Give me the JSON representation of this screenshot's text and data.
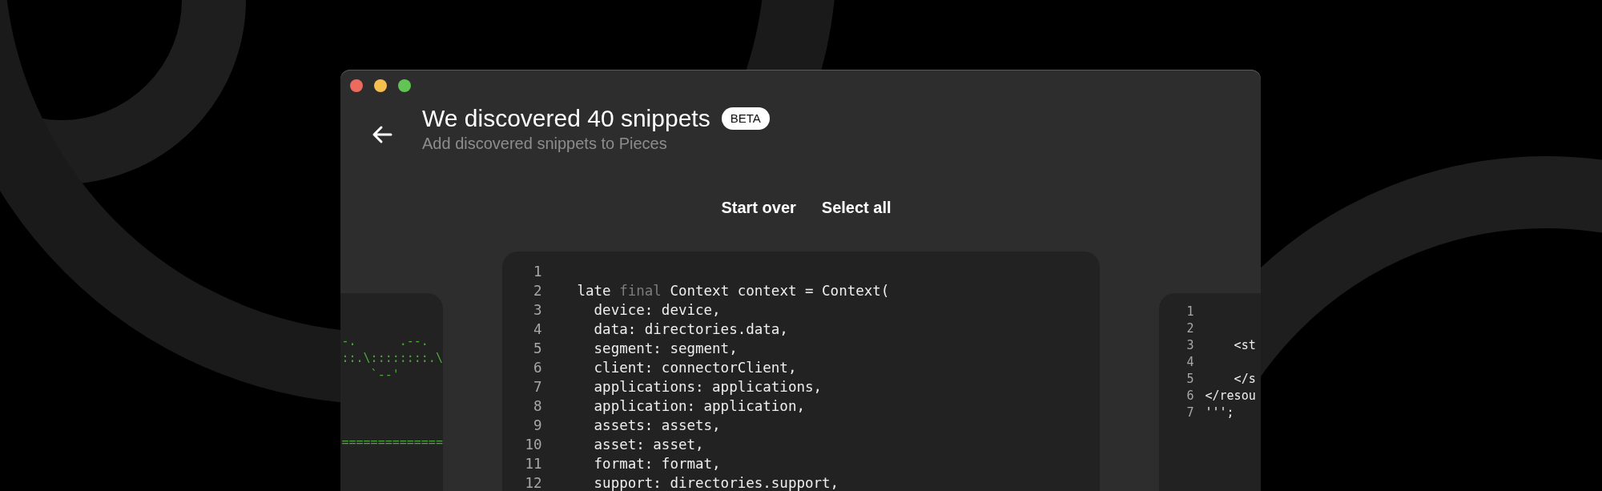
{
  "header": {
    "title": "We discovered 40 snippets",
    "badge": "BETA",
    "subtitle": "Add discovered snippets to Pieces"
  },
  "actions": [
    "Start over",
    "Select all"
  ],
  "snippets": [
    {
      "kind": "art",
      "art": "-.      .--.\n::.\\::::::::.\\\n    `--'\n\n\n\n=============="
    },
    {
      "kind": "code",
      "lines": [
        {
          "number": "1"
        },
        {
          "number": "2",
          "tokens": [
            {
              "text": "late "
            },
            {
              "text": "final",
              "kind": "keyword"
            },
            {
              "text": " Context context = Context("
            }
          ]
        },
        {
          "number": "3",
          "tokens": [
            {
              "text": "  device: device,"
            }
          ]
        },
        {
          "number": "4",
          "tokens": [
            {
              "text": "  data: directories.data,"
            }
          ]
        },
        {
          "number": "5",
          "tokens": [
            {
              "text": "  segment: segment,"
            }
          ]
        },
        {
          "number": "6",
          "tokens": [
            {
              "text": "  client: connectorClient,"
            }
          ]
        },
        {
          "number": "7",
          "tokens": [
            {
              "text": "  applications: applications,"
            }
          ]
        },
        {
          "number": "8",
          "tokens": [
            {
              "text": "  application: application,"
            }
          ]
        },
        {
          "number": "9",
          "tokens": [
            {
              "text": "  assets: assets,"
            }
          ]
        },
        {
          "number": "10",
          "tokens": [
            {
              "text": "  asset: asset,"
            }
          ]
        },
        {
          "number": "11",
          "tokens": [
            {
              "text": "  format: format,"
            }
          ]
        },
        {
          "number": "12",
          "tokens": [
            {
              "text": "  support: directories.support,"
            }
          ]
        }
      ]
    },
    {
      "kind": "code",
      "lines": [
        {
          "number": "1"
        },
        {
          "number": "2"
        },
        {
          "number": "3",
          "tokens": [
            {
              "text": "    <st"
            }
          ]
        },
        {
          "number": "4"
        },
        {
          "number": "5",
          "tokens": [
            {
              "text": "    </s"
            }
          ]
        },
        {
          "number": "6",
          "tokens": [
            {
              "text": "</resou"
            }
          ]
        },
        {
          "number": "7",
          "tokens": [
            {
              "text": "''';"
            }
          ]
        }
      ]
    }
  ]
}
